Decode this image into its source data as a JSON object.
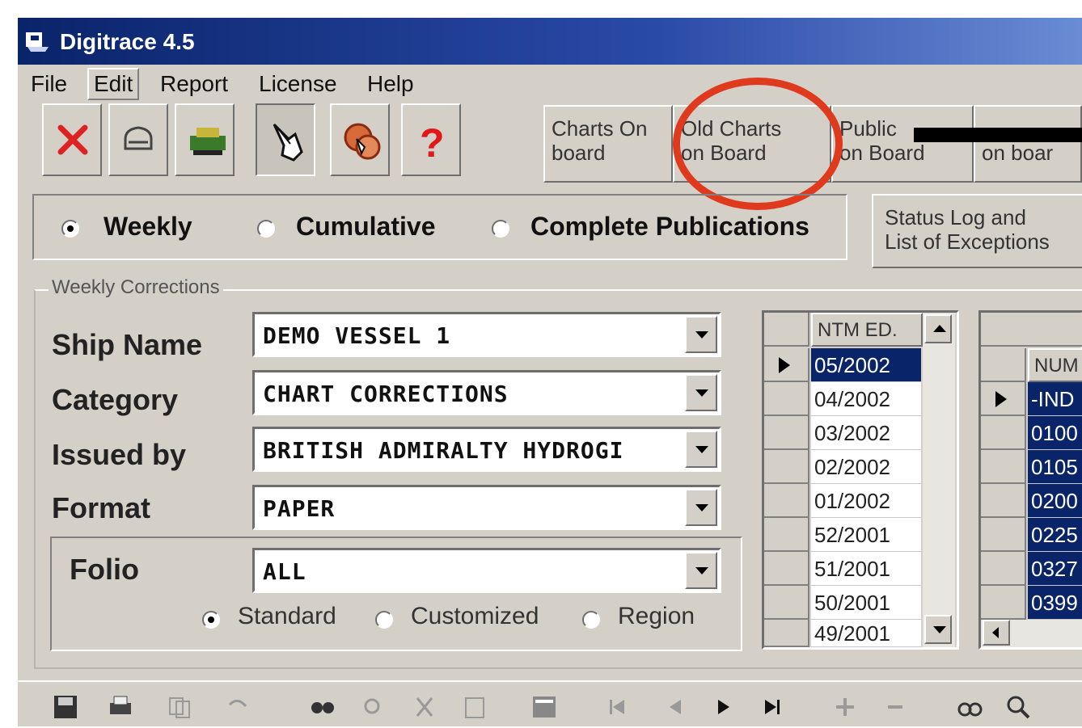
{
  "window": {
    "title": "Digitrace 4.5"
  },
  "menu": {
    "items": [
      "File",
      "Edit",
      "Report",
      "License",
      "Help"
    ]
  },
  "toolbar": {
    "icons": [
      "close-icon",
      "print-icon",
      "stamp-icon",
      "pointer-icon",
      "gears-icon",
      "help-icon"
    ]
  },
  "tabs": {
    "charts_on_board": "Charts On\nboard",
    "old_charts_on_board": "Old Charts\non Board",
    "publications_on_board": "Public\non Board",
    "on_board": "\non boar"
  },
  "modes": {
    "weekly": "Weekly",
    "cumulative": "Cumulative",
    "complete_publications": "Complete Publications",
    "selected": "weekly"
  },
  "status_button": "Status Log and\nList of Exceptions",
  "weekly_corrections": {
    "legend": "Weekly Corrections",
    "ship_name_label": "Ship Name",
    "ship_name_value": "DEMO VESSEL 1",
    "category_label": "Category",
    "category_value": "CHART CORRECTIONS",
    "issued_by_label": "Issued by",
    "issued_by_value": "BRITISH ADMIRALTY HYDROGI",
    "format_label": "Format",
    "format_value": "PAPER",
    "folio_label": "Folio",
    "folio_value": "ALL",
    "folio_options": {
      "standard": "Standard",
      "customized": "Customized",
      "region": "Region",
      "selected": "standard"
    }
  },
  "ntm_grid": {
    "header": "NTM ED.",
    "rows": [
      "05/2002",
      "04/2002",
      "03/2002",
      "02/2002",
      "01/2002",
      "52/2001",
      "51/2001",
      "50/2001",
      "49/2001"
    ],
    "selected_index": 0
  },
  "num_grid": {
    "header": "NUM",
    "rows": [
      "-IND",
      "0100",
      "0105",
      "0200",
      "0225",
      "0327",
      "0399"
    ]
  },
  "highlight_color": "#e03a1e",
  "selection_color": "#0a246a"
}
